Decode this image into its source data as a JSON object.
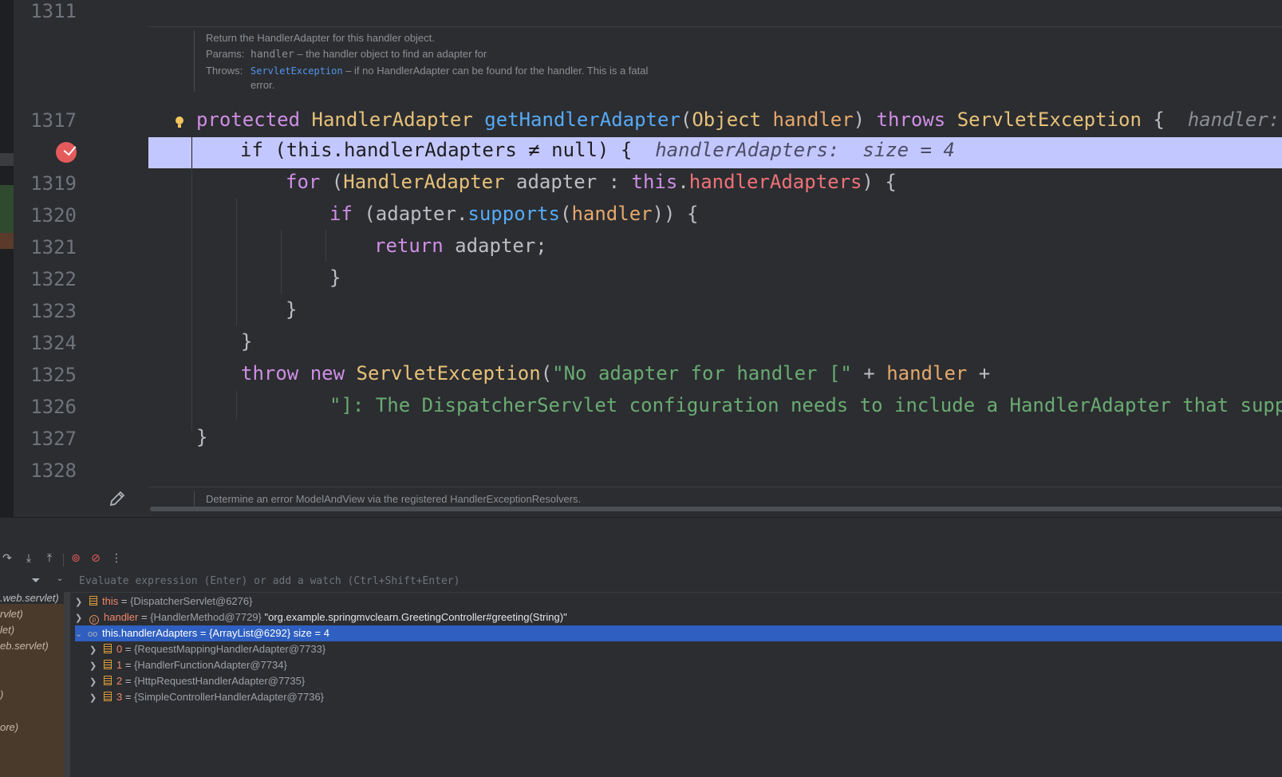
{
  "colors": {
    "editor_bg": "#2b2d30",
    "exec_line": "#c3c7ff",
    "selection": "#2e5fc1",
    "breakpoint": "#e55b5b"
  },
  "gutter": {
    "lines": [
      "1311",
      "1317",
      "1319",
      "1320",
      "1321",
      "1322",
      "1323",
      "1324",
      "1325",
      "1326",
      "1327",
      "1328"
    ],
    "icons": [
      "breakpoint-icon",
      "lightbulb-icon",
      "edit-pencil-icon"
    ]
  },
  "doc_top": {
    "summary": "Return the HandlerAdapter for this handler object.",
    "params_label": "Params:",
    "params_name": "handler",
    "params_text": " – the handler object to find an adapter for",
    "throws_label": "Throws:",
    "throws_link": "ServletException",
    "throws_text": " – if no HandlerAdapter can be found for the handler. This is a fatal",
    "throws_text2": "error."
  },
  "code": {
    "l1317": {
      "kw": "protected",
      "type": "HandlerAdapter",
      "fn": "getHandlerAdapter",
      "p1": "(",
      "ptype": "Object",
      "pname": "handler",
      "p2": ")",
      "throws": "throws",
      "exc": "ServletException",
      "brace": " {",
      "hint": "handler: \"o"
    },
    "l1318": {
      "text": "if (this.handlerAdapters ≠ null) {",
      "hint": "handlerAdapters:  size = 4"
    },
    "l1319": {
      "kw": "for",
      "a": " (",
      "type": "HandlerAdapter",
      "b": " adapter : ",
      "this": "this",
      "dot": ".",
      "field": "handlerAdapters",
      "c": ") {"
    },
    "l1320": {
      "kw": "if",
      "a": " (adapter.",
      "fn": "supports",
      "b": "(",
      "pname": "handler",
      "c": ")) {"
    },
    "l1321": {
      "kw": "return",
      "a": " adapter;"
    },
    "l1322": {
      "text": "}"
    },
    "l1323": {
      "text": "}"
    },
    "l1324": {
      "text": "}"
    },
    "l1325": {
      "kw1": "throw",
      "kw2": "new",
      "type": "ServletException",
      "a": "(",
      "str": "\"No adapter for handler [\"",
      "b": " + ",
      "pname": "handler",
      "c": " +"
    },
    "l1326": {
      "str": "\"]: The DispatcherServlet configuration needs to include a HandlerAdapter that support"
    },
    "l1327": {
      "text": "}"
    }
  },
  "doc_bottom": {
    "summary": "Determine an error ModelAndView via the registered HandlerExceptionResolvers."
  },
  "debugger": {
    "eval_placeholder": "Evaluate expression (Enter) or add a watch (Ctrl+Shift+Enter)",
    "frames": [
      ".web.servlet)",
      "rvlet)",
      "let)",
      "eb.servlet)",
      ")",
      "ore)"
    ],
    "variables": [
      {
        "name": "this",
        "eq": " = ",
        "value": "{DispatcherServlet@6276}"
      },
      {
        "name": "handler",
        "eq": " = ",
        "value": "{HandlerMethod@7729}",
        "extra": " \"org.example.springmvclearn.GreetingController#greeting(String)\""
      },
      {
        "name": "this.handlerAdapters",
        "eq": " = ",
        "value": "{ArrayList@6292}",
        "extra": "  size = 4"
      },
      {
        "name": "0",
        "eq": " = ",
        "value": "{RequestMappingHandlerAdapter@7733}"
      },
      {
        "name": "1",
        "eq": " = ",
        "value": "{HandlerFunctionAdapter@7734}"
      },
      {
        "name": "2",
        "eq": " = ",
        "value": "{HttpRequestHandlerAdapter@7735}"
      },
      {
        "name": "3",
        "eq": " = ",
        "value": "{SimpleControllerHandlerAdapter@7736}"
      }
    ]
  }
}
